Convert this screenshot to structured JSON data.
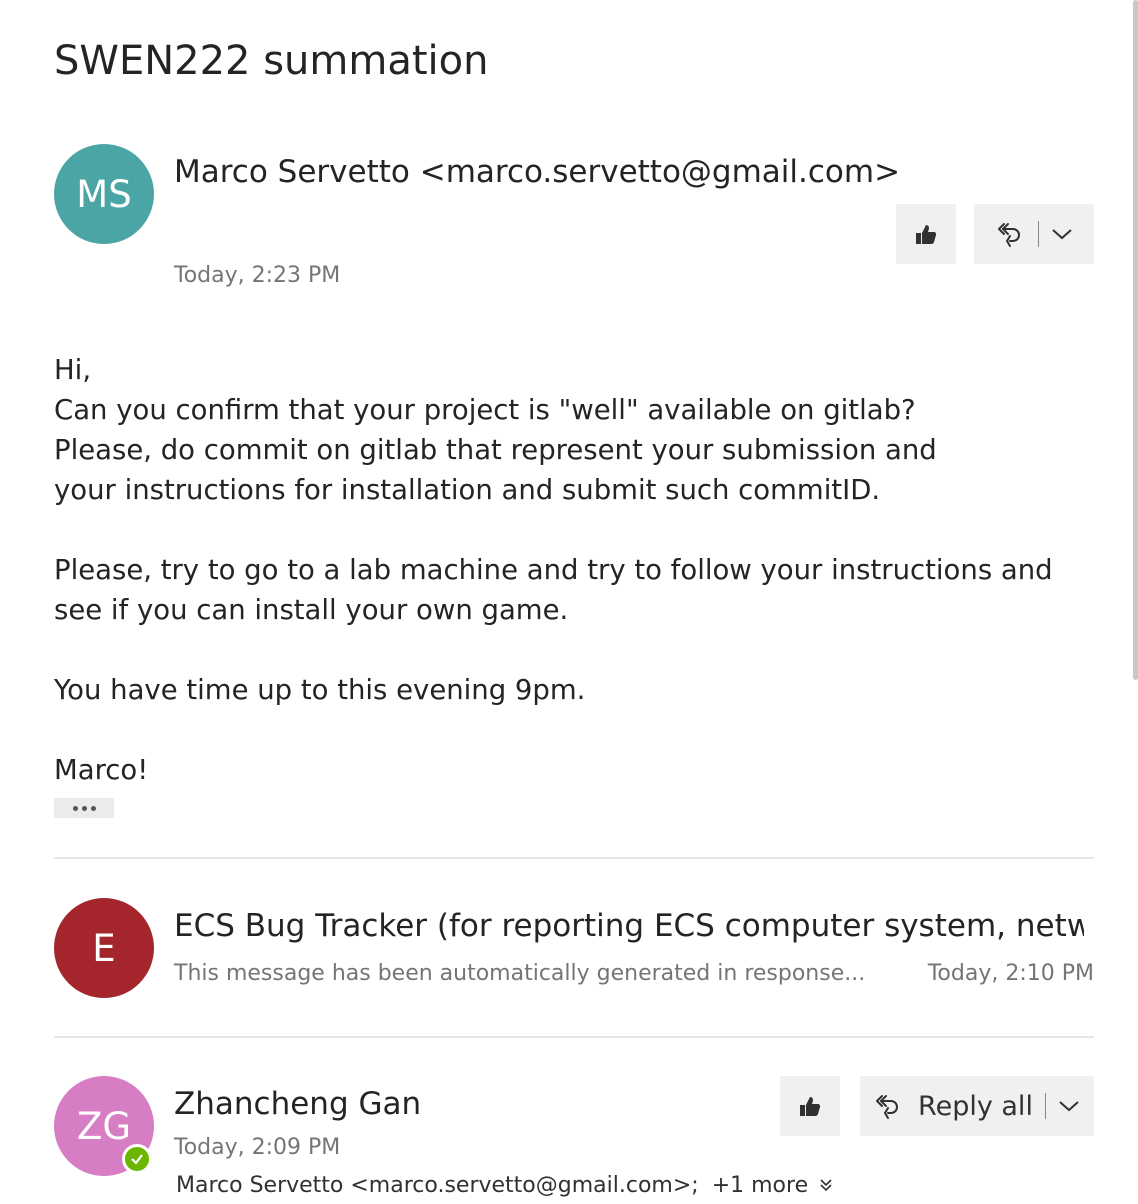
{
  "subject": "SWEN222 summation",
  "messages": [
    {
      "initials": "MS",
      "avatar_color": "#4aa5a4",
      "from": "Marco Servetto <marco.servetto@gmail.com>",
      "time": "Today, 2:23 PM",
      "body": [
        "Hi,",
        "Can you confirm that your project is \"well\" available on gitlab?",
        "Please, do commit on gitlab that represent your submission and your instructions for installation and submit such commitID.",
        "",
        "Please, try to go to a lab machine and try to follow your instructions and see if you can install your own game.",
        "",
        "You have time up to this evening 9pm.",
        "",
        "Marco!"
      ]
    },
    {
      "initials": "E",
      "avatar_color": "#a4262c",
      "from": "ECS Bug Tracker (for reporting ECS computer system, networ",
      "preview": "This message has been automatically generated in response...",
      "time": "Today, 2:10 PM"
    },
    {
      "initials": "ZG",
      "avatar_color": "#d77dc4",
      "from": "Zhancheng Gan",
      "time": "Today, 2:09 PM",
      "to": "Marco Servetto <marco.servetto@gmail.com>;",
      "to_more": "+1 more",
      "reply_all_label": "Reply all"
    }
  ],
  "icons": {
    "like": "thumbs-up-icon",
    "reply_all": "reply-all-icon",
    "dropdown": "chevron-down-icon",
    "more": "ellipsis-icon",
    "verified": "check-badge-icon",
    "expand": "double-chevron-down-icon"
  },
  "colors": {
    "button_bg": "#f0f0f0",
    "meta_text": "#757575",
    "verified_badge": "#6bb700"
  }
}
